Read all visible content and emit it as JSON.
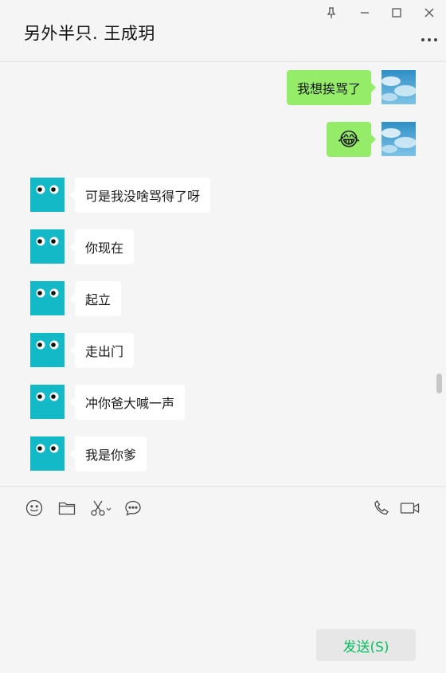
{
  "chat": {
    "title": "另外半只. 王成玥"
  },
  "window_controls": {
    "pin": "pin-icon",
    "minimize": "minimize-icon",
    "maximize": "maximize-icon",
    "close": "close-icon",
    "more": "more-icon"
  },
  "messages": [
    {
      "sender": "me",
      "text": "我想挨骂了"
    },
    {
      "sender": "me",
      "text": "😂"
    },
    {
      "sender": "peer",
      "text": "可是我没啥骂得了呀"
    },
    {
      "sender": "peer",
      "text": "你现在"
    },
    {
      "sender": "peer",
      "text": "起立"
    },
    {
      "sender": "peer",
      "text": "走出门"
    },
    {
      "sender": "peer",
      "text": "冲你爸大喊一声"
    },
    {
      "sender": "peer",
      "text": "我是你爹"
    }
  ],
  "toolbar": {
    "icons": [
      "emoji-icon",
      "folder-icon",
      "scissors-icon",
      "chat-history-icon",
      "phone-icon",
      "video-call-icon"
    ]
  },
  "composer": {
    "send_label": "发送(S)"
  },
  "colors": {
    "my_bubble": "#95ec69",
    "peer_bubble": "#ffffff",
    "peer_avatar": "#14b9c8",
    "send_text": "#07c160"
  }
}
